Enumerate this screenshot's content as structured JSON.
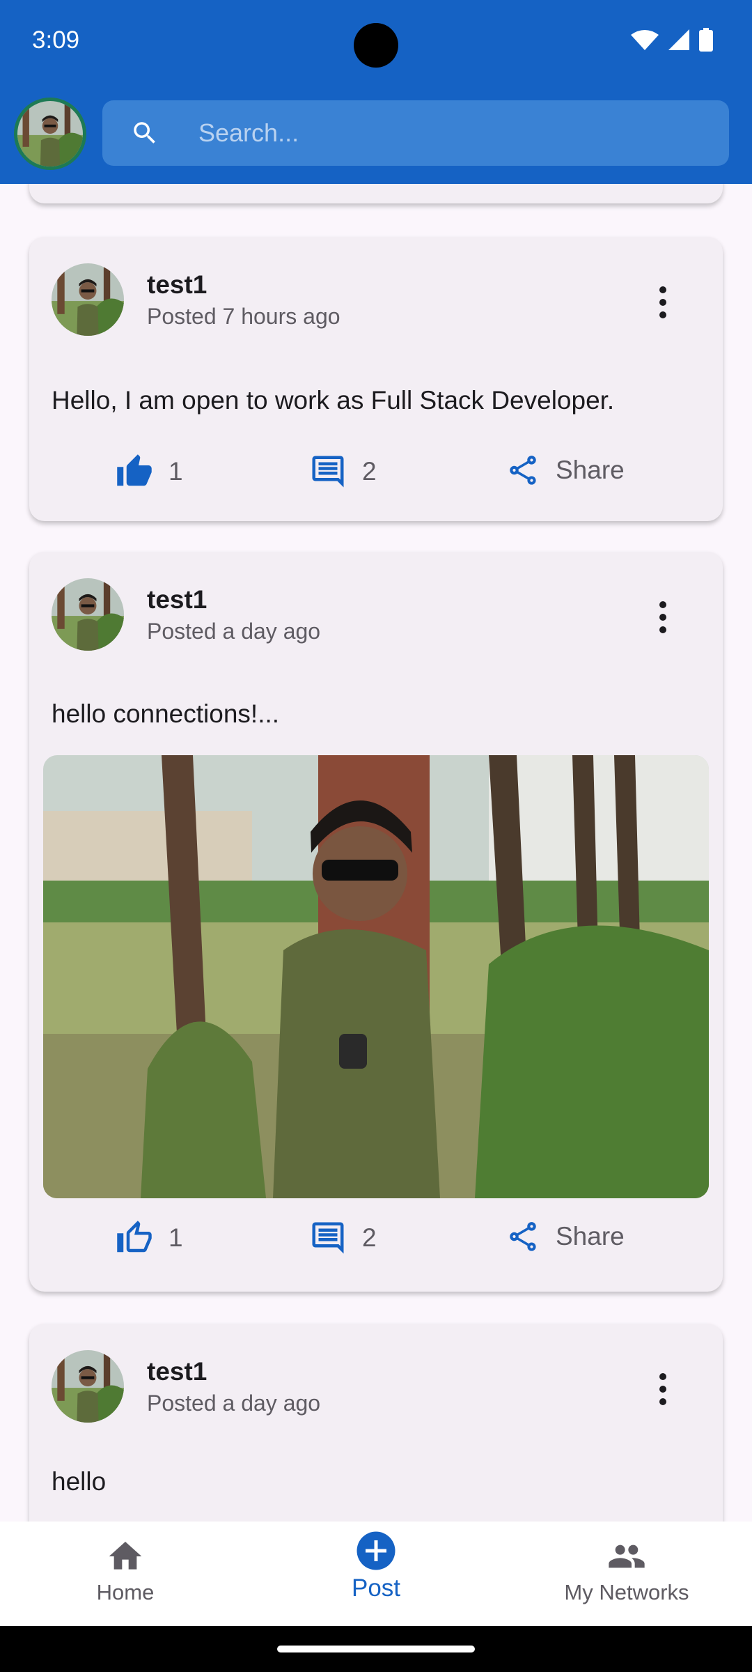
{
  "status_bar": {
    "time": "3:09"
  },
  "search": {
    "placeholder": "Search..."
  },
  "posts": [
    {
      "username": "test1",
      "posted": "Posted 7 hours ago",
      "text": "Hello, I am open to work as Full Stack Developer.",
      "likes": "1",
      "comments": "2",
      "share_label": "Share",
      "liked": true
    },
    {
      "username": "test1",
      "posted": "Posted a day ago",
      "text": "hello connections!...",
      "likes": "1",
      "comments": "2",
      "share_label": "Share",
      "liked": false,
      "has_image": true
    },
    {
      "username": "test1",
      "posted": "Posted a day ago",
      "text": "hello"
    }
  ],
  "nav": {
    "home": "Home",
    "post": "Post",
    "networks": "My Networks"
  },
  "colors": {
    "primary": "#1562c4",
    "card": "#f3eef4",
    "background": "#fbf6fc"
  }
}
